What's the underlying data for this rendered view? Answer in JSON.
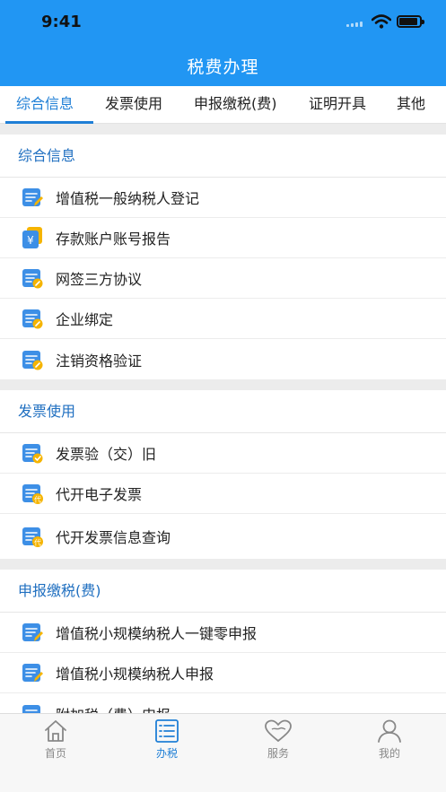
{
  "status_bar": {
    "time": "9:41"
  },
  "header": {
    "title": "税费办理"
  },
  "tabs": [
    {
      "label": "综合信息",
      "active": true
    },
    {
      "label": "发票使用"
    },
    {
      "label": "申报缴税(费)"
    },
    {
      "label": "证明开具"
    },
    {
      "label": "其他"
    }
  ],
  "sections": [
    {
      "title": "综合信息",
      "items": [
        {
          "label": "增值税一般纳税人登记",
          "icon": "doc-pencil-icon"
        },
        {
          "label": "存款账户账号报告",
          "icon": "yuan-card-icon"
        },
        {
          "label": "网签三方协议",
          "icon": "doc-link-icon"
        },
        {
          "label": "企业绑定",
          "icon": "doc-link-icon"
        },
        {
          "label": "注销资格验证",
          "icon": "doc-link-icon"
        }
      ]
    },
    {
      "title": "发票使用",
      "items": [
        {
          "label": "发票验（交）旧",
          "icon": "doc-check-icon"
        },
        {
          "label": "代开电子发票",
          "icon": "doc-dai-icon",
          "badge": "代"
        },
        {
          "label": "代开发票信息查询",
          "icon": "doc-dai-icon",
          "badge": "代"
        }
      ]
    },
    {
      "title": "申报缴税(费)",
      "items": [
        {
          "label": "增值税小规模纳税人一键零申报",
          "icon": "doc-pencil-icon"
        },
        {
          "label": "增值税小规模纳税人申报",
          "icon": "doc-pencil-icon"
        },
        {
          "label": "附加税（费）申报",
          "icon": "doc-pencil-icon"
        }
      ]
    }
  ],
  "tabbar": [
    {
      "label": "首页",
      "icon": "home-icon"
    },
    {
      "label": "办税",
      "icon": "list-icon",
      "active": true
    },
    {
      "label": "服务",
      "icon": "heart-icon"
    },
    {
      "label": "我的",
      "icon": "person-icon"
    }
  ],
  "colors": {
    "primary": "#2196f3",
    "accent": "#1f7fd6",
    "icon_badge": "#f5b400"
  }
}
